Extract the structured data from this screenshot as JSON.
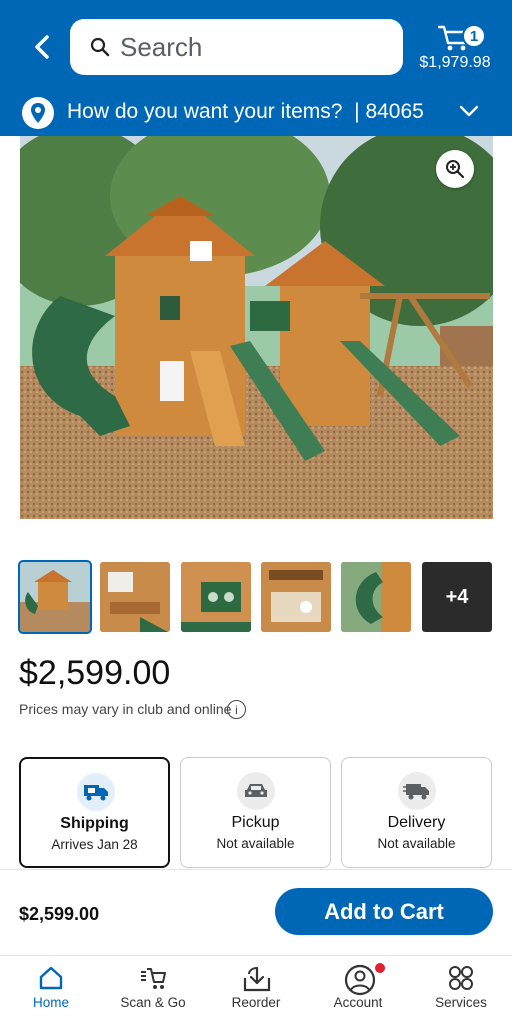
{
  "header": {
    "search_placeholder": "Search",
    "cart_count": "1",
    "cart_total": "$1,979.98",
    "delivery_prompt": "How do you want your items?",
    "zip": "84065"
  },
  "product": {
    "image_description": "wooden-playset-main-image",
    "thumbnails": [
      {
        "name": "thumb-1",
        "selected": true
      },
      {
        "name": "thumb-2",
        "selected": false
      },
      {
        "name": "thumb-3",
        "selected": false
      },
      {
        "name": "thumb-4",
        "selected": false
      },
      {
        "name": "thumb-5",
        "selected": false
      },
      {
        "name": "thumb-more",
        "label": "+4"
      }
    ],
    "price": "$2,599.00",
    "price_note": "Prices may vary in club and online"
  },
  "fulfillment": [
    {
      "title": "Shipping",
      "subtitle": "Arrives Jan 28",
      "icon": "shipping-truck-icon",
      "selected": true
    },
    {
      "title": "Pickup",
      "subtitle": "Not available",
      "icon": "car-icon",
      "selected": false
    },
    {
      "title": "Delivery",
      "subtitle": "Not available",
      "icon": "delivery-truck-icon",
      "selected": false
    }
  ],
  "cart_bar": {
    "price": "$2,599.00",
    "button_label": "Add to Cart"
  },
  "nav": [
    {
      "label": "Home",
      "icon": "home-icon",
      "active": true
    },
    {
      "label": "Scan & Go",
      "icon": "scan-cart-icon",
      "active": false
    },
    {
      "label": "Reorder",
      "icon": "reorder-icon",
      "active": false
    },
    {
      "label": "Account",
      "icon": "account-icon",
      "active": false
    },
    {
      "label": "Services",
      "icon": "services-icon",
      "active": false
    }
  ],
  "colors": {
    "brand_blue": "#0067b6",
    "alert_red": "#e0202e"
  }
}
